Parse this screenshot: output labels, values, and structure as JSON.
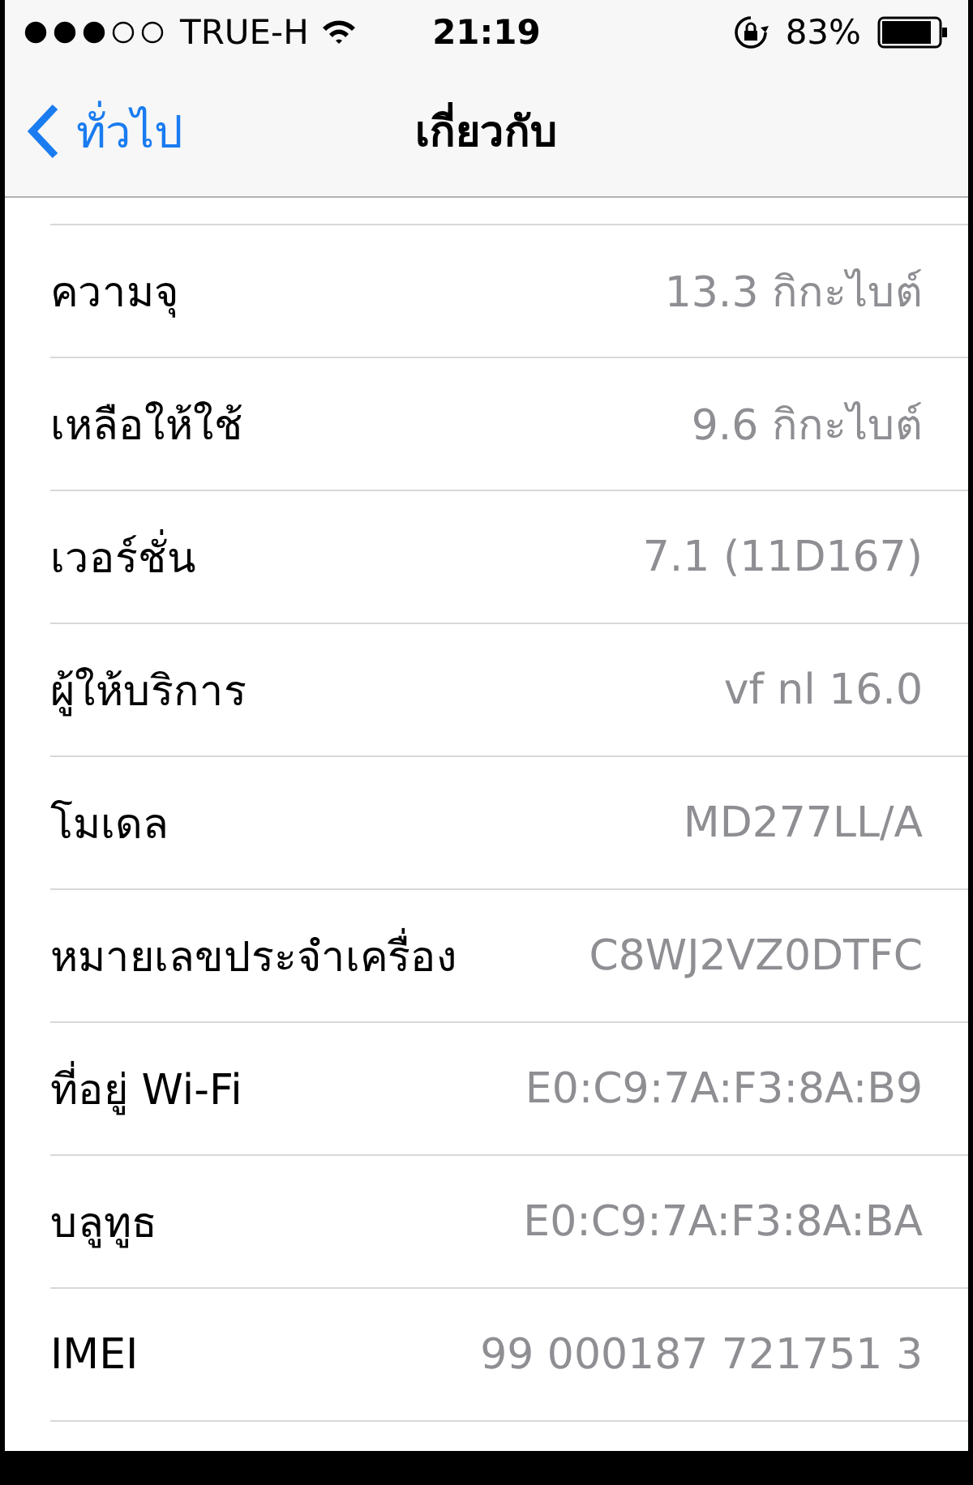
{
  "status_bar": {
    "carrier": "TRUE-H",
    "time": "21:19",
    "battery": "83%"
  },
  "nav": {
    "back": "ทั่วไป",
    "title": "เกี่ยวกับ"
  },
  "rows": [
    {
      "label": "ความจุ",
      "value": "13.3 กิกะไบต์"
    },
    {
      "label": "เหลือให้ใช้",
      "value": "9.6 กิกะไบต์"
    },
    {
      "label": "เวอร์ชั่น",
      "value": "7.1 (11D167)"
    },
    {
      "label": "ผู้ให้บริการ",
      "value": "vf nl 16.0"
    },
    {
      "label": "โมเดล",
      "value": "MD277LL/A"
    },
    {
      "label": "หมายเลขประจำเครื่อง",
      "value": "C8WJ2VZ0DTFC"
    },
    {
      "label": "ที่อยู่ Wi-Fi",
      "value": "E0:C9:7A:F3:8A:B9"
    },
    {
      "label": "บลูทูธ",
      "value": "E0:C9:7A:F3:8A:BA"
    },
    {
      "label": "IMEI",
      "value": "99 000187 721751 3"
    }
  ]
}
